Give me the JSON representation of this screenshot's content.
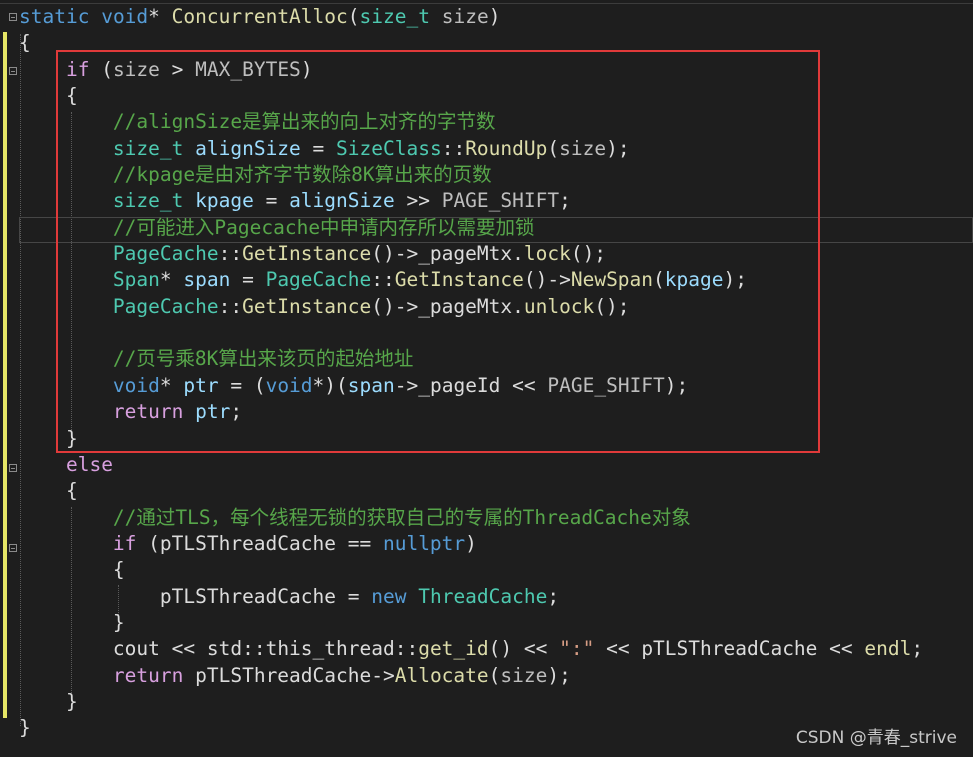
{
  "code": {
    "l1": {
      "t1": "static",
      "t2": " ",
      "t3": "void",
      "t4": "* ",
      "t5": "ConcurrentAlloc",
      "t6": "(",
      "t7": "size_t",
      "t8": " ",
      "t9": "size",
      "t10": ")"
    },
    "l2": {
      "t1": "{"
    },
    "l3": {
      "t1": "    ",
      "t2": "if",
      "t3": " (",
      "t4": "size",
      "t5": " > ",
      "t6": "MAX_BYTES",
      "t7": ")"
    },
    "l4": {
      "t1": "    {"
    },
    "l5": {
      "t1": "        ",
      "t2": "//alignSize是算出来的向上对齐的字节数"
    },
    "l6": {
      "t1": "        ",
      "t2": "size_t",
      "t3": " ",
      "t4": "alignSize",
      "t5": " = ",
      "t6": "SizeClass",
      "t7": "::",
      "t8": "RoundUp",
      "t9": "(",
      "t10": "size",
      "t11": ");"
    },
    "l7": {
      "t1": "        ",
      "t2": "//kpage是由对齐字节数除8K算出来的页数"
    },
    "l8": {
      "t1": "        ",
      "t2": "size_t",
      "t3": " ",
      "t4": "kpage",
      "t5": " = ",
      "t6": "alignSize",
      "t7": " >> ",
      "t8": "PAGE_SHIFT",
      "t9": ";"
    },
    "l9": {
      "t1": "        ",
      "t2": "//可能进入Pagecache中申请内存所以需要加锁"
    },
    "l10": {
      "t1": "        ",
      "t2": "PageCache",
      "t3": "::",
      "t4": "GetInstance",
      "t5": "()->",
      "t6": "_pageMtx",
      "t7": ".",
      "t8": "lock",
      "t9": "();"
    },
    "l11": {
      "t1": "        ",
      "t2": "Span",
      "t3": "* ",
      "t4": "span",
      "t5": " = ",
      "t6": "PageCache",
      "t7": "::",
      "t8": "GetInstance",
      "t9": "()->",
      "t10": "NewSpan",
      "t11": "(",
      "t12": "kpage",
      "t13": ");"
    },
    "l12": {
      "t1": "        ",
      "t2": "PageCache",
      "t3": "::",
      "t4": "GetInstance",
      "t5": "()->",
      "t6": "_pageMtx",
      "t7": ".",
      "t8": "unlock",
      "t9": "();"
    },
    "l13": {
      "t1": ""
    },
    "l14": {
      "t1": "        ",
      "t2": "//页号乘8K算出来该页的起始地址"
    },
    "l15": {
      "t1": "        ",
      "t2": "void",
      "t3": "* ",
      "t4": "ptr",
      "t5": " = (",
      "t6": "void",
      "t7": "*)(",
      "t8": "span",
      "t9": "->",
      "t10": "_pageId",
      "t11": " << ",
      "t12": "PAGE_SHIFT",
      "t13": ");"
    },
    "l16": {
      "t1": "        ",
      "t2": "return",
      "t3": " ",
      "t4": "ptr",
      "t5": ";"
    },
    "l17": {
      "t1": "    }"
    },
    "l18": {
      "t1": "    ",
      "t2": "else"
    },
    "l19": {
      "t1": "    {"
    },
    "l20": {
      "t1": "        ",
      "t2": "//通过TLS，每个线程无锁的获取自己的专属的ThreadCache对象"
    },
    "l21": {
      "t1": "        ",
      "t2": "if",
      "t3": " (",
      "t4": "pTLSThreadCache",
      "t5": " == ",
      "t6": "nullptr",
      "t7": ")"
    },
    "l22": {
      "t1": "        {"
    },
    "l23": {
      "t1": "            ",
      "t2": "pTLSThreadCache",
      "t3": " = ",
      "t4": "new",
      "t5": " ",
      "t6": "ThreadCache",
      "t7": ";"
    },
    "l24": {
      "t1": "        }"
    },
    "l25": {
      "t1": "        ",
      "t2": "cout",
      "t3": " << ",
      "t4": "std",
      "t5": "::",
      "t6": "this_thread",
      "t7": "::",
      "t8": "get_id",
      "t9": "() << ",
      "t10": "\":\"",
      "t11": " << ",
      "t12": "pTLSThreadCache",
      "t13": " << ",
      "t14": "endl",
      "t15": ";"
    },
    "l26": {
      "t1": "        ",
      "t2": "return",
      "t3": " ",
      "t4": "pTLSThreadCache",
      "t5": "->",
      "t6": "Allocate",
      "t7": "(",
      "t8": "size",
      "t9": ");"
    },
    "l27": {
      "t1": "    }"
    },
    "l28": {
      "t1": "}"
    }
  },
  "watermark": "CSDN @青春_strive",
  "colors": {
    "background": "#1e1e1e",
    "keyword": "#569cd6",
    "control_keyword": "#d8a0df",
    "type": "#4ec9b0",
    "function": "#dcdcaa",
    "variable": "#9cdcfe",
    "comment": "#57a64a",
    "highlight_box": "#e03a3a",
    "change_bar": "#e6e666"
  }
}
